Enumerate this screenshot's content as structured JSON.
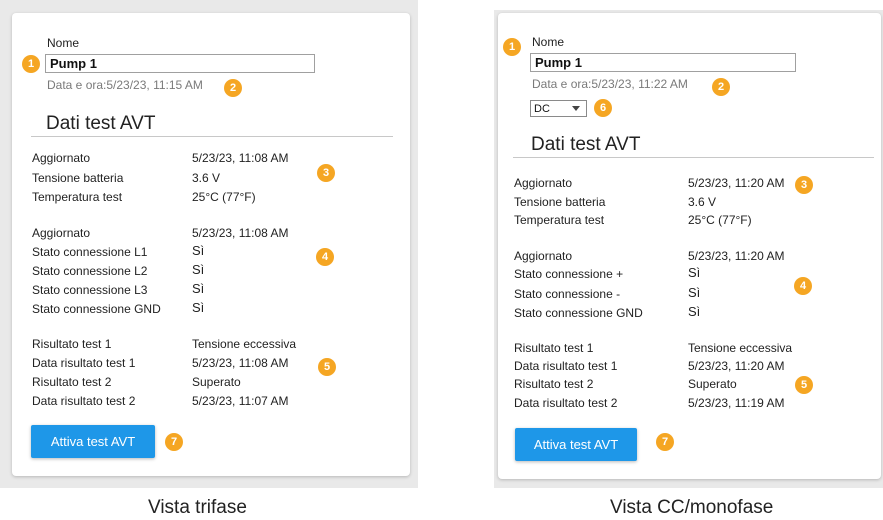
{
  "left": {
    "name_label": "Nome",
    "name_value": "Pump 1",
    "date_line": "Data e ora:5/23/23, 11:15 AM",
    "section_title": "Dati test AVT",
    "group1": [
      {
        "label": "Aggiornato",
        "value": "5/23/23, 11:08 AM"
      },
      {
        "label": "Tensione batteria",
        "value": "3.6 V"
      },
      {
        "label": "Temperatura test",
        "value": "25°C (77°F)"
      }
    ],
    "group2": [
      {
        "label": "Aggiornato",
        "value": "5/23/23, 11:08 AM"
      },
      {
        "label": "Stato connessione L1",
        "value": "Sì"
      },
      {
        "label": "Stato connessione L2",
        "value": "Sì"
      },
      {
        "label": "Stato connessione L3",
        "value": "Sì"
      },
      {
        "label": "Stato connessione GND",
        "value": "Sì"
      }
    ],
    "group3": [
      {
        "label": "Risultato test 1",
        "value": "Tensione eccessiva"
      },
      {
        "label": "Data risultato test 1",
        "value": "5/23/23, 11:08 AM"
      },
      {
        "label": "Risultato test 2",
        "value": "Superato"
      },
      {
        "label": "Data risultato test 2",
        "value": "5/23/23, 11:07 AM"
      }
    ],
    "button_label": "Attiva test AVT",
    "badges": [
      "1",
      "2",
      "3",
      "4",
      "5",
      "7"
    ],
    "caption": "Vista trifase"
  },
  "right": {
    "name_label": "Nome",
    "name_value": "Pump 1",
    "date_line": "Data e ora:5/23/23, 11:22 AM",
    "select_value": "DC",
    "section_title": "Dati test AVT",
    "group1": [
      {
        "label": "Aggiornato",
        "value": "5/23/23, 11:20 AM"
      },
      {
        "label": "Tensione batteria",
        "value": "3.6 V"
      },
      {
        "label": "Temperatura test",
        "value": "25°C (77°F)"
      }
    ],
    "group2": [
      {
        "label": "Aggiornato",
        "value": "5/23/23, 11:20 AM"
      },
      {
        "label": "Stato connessione +",
        "value": "Sì"
      },
      {
        "label": "Stato connessione -",
        "value": "Sì"
      },
      {
        "label": "Stato connessione GND",
        "value": "Sì"
      }
    ],
    "group3": [
      {
        "label": "Risultato test 1",
        "value": "Tensione eccessiva"
      },
      {
        "label": "Data risultato test 1",
        "value": "5/23/23, 11:20 AM"
      },
      {
        "label": "Risultato test 2",
        "value": "Superato"
      },
      {
        "label": "Data risultato test 2",
        "value": "5/23/23, 11:19 AM"
      }
    ],
    "button_label": "Attiva test AVT",
    "badges": [
      "1",
      "2",
      "6",
      "3",
      "4",
      "5",
      "7"
    ],
    "caption": "Vista CC/monofase"
  },
  "colors": {
    "badge": "#f5a623",
    "button": "#1e97e8",
    "frame": "#e9e9e9"
  }
}
